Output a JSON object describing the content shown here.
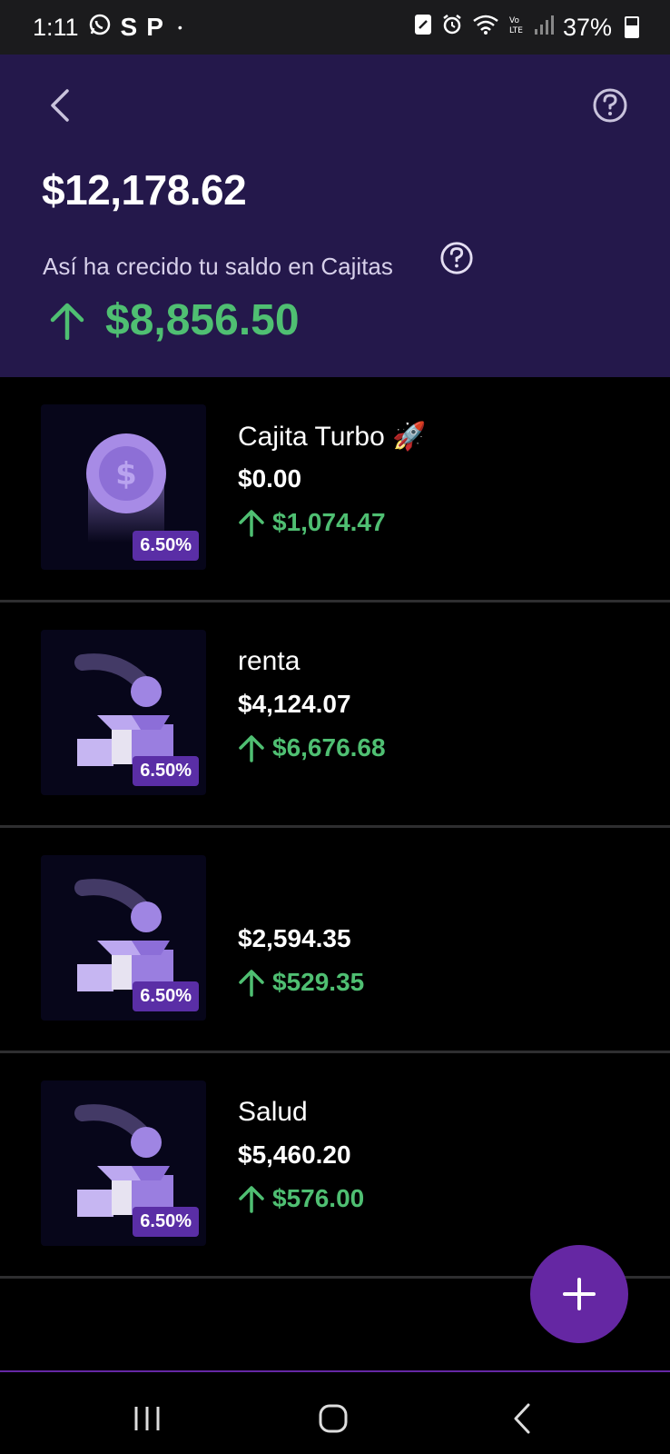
{
  "status_bar": {
    "time": "1:11",
    "s_glyph": "S",
    "p_glyph": "P",
    "dot": "•",
    "battery": "37%"
  },
  "header": {
    "balance": "$12,178.62",
    "growth_label": "Así ha crecido tu saldo en Cajitas",
    "growth_amount": "$8,856.50"
  },
  "cajitas": [
    {
      "name": "Cajita Turbo 🚀",
      "amount": "$0.00",
      "gain": "$1,074.47",
      "rate": "6.50%",
      "image": "coin-icon"
    },
    {
      "name": "renta",
      "amount": "$4,124.07",
      "gain": "$6,676.68",
      "rate": "6.50%",
      "image": "box-coin-icon"
    },
    {
      "name": "",
      "amount": "$2,594.35",
      "gain": "$529.35",
      "rate": "6.50%",
      "image": "box-coin-icon"
    },
    {
      "name": "Salud",
      "amount": "$5,460.20",
      "gain": "$576.00",
      "rate": "6.50%",
      "image": "box-coin-icon"
    }
  ],
  "colors": {
    "header_bg": "#24184b",
    "accent": "#6527a3",
    "positive": "#4fbf72",
    "badge": "#5a2ea6"
  }
}
